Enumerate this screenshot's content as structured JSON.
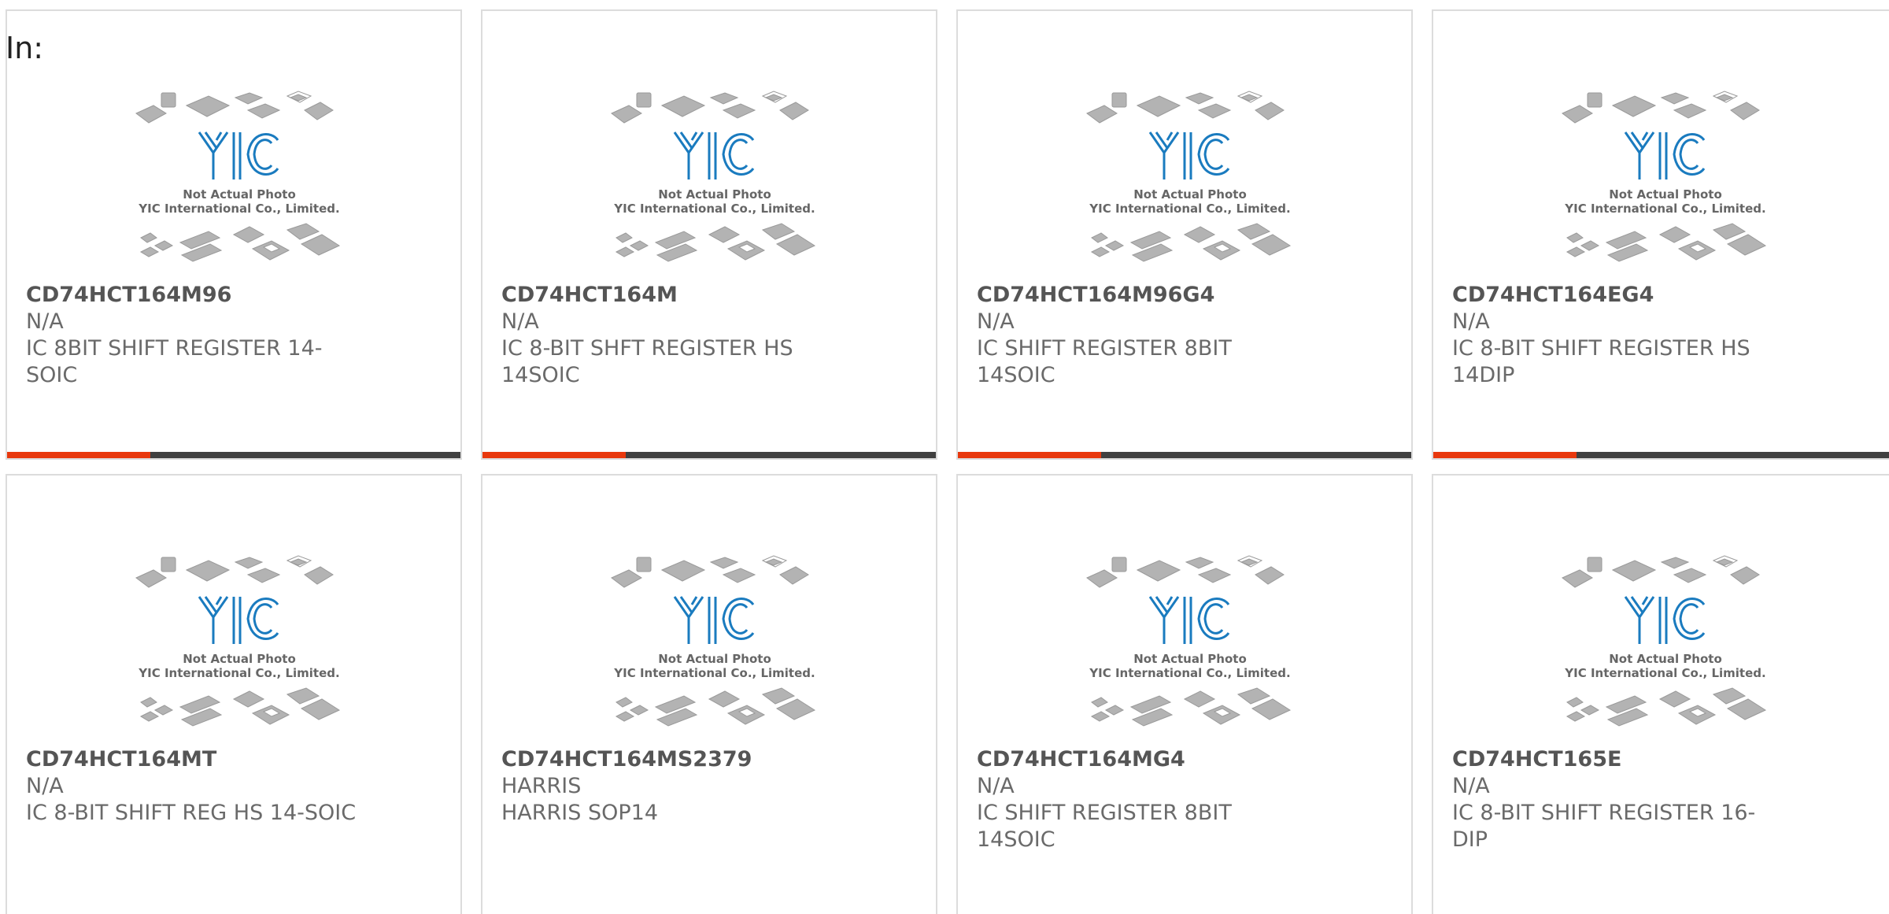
{
  "header": {
    "label": "In:"
  },
  "colors": {
    "accent": "#e8380d",
    "bar_dark": "#404040",
    "logo_blue": "#1a7bbf",
    "chip_gray": "#b3b3b3",
    "border": "#dcdcdc"
  },
  "placeholder_image": {
    "icon": "yic-logo-icon",
    "logo_text": "YIC",
    "line1": "Not Actual Photo",
    "line2": "YIC International Co., Limited."
  },
  "products": [
    {
      "part": "CD74HCT164M96",
      "manufacturer": "N/A",
      "desc1": "IC 8BIT SHIFT REGISTER 14-",
      "desc2": "SOIC"
    },
    {
      "part": "CD74HCT164M",
      "manufacturer": "N/A",
      "desc1": "IC 8-BIT SHFT REGISTER HS",
      "desc2": "14SOIC"
    },
    {
      "part": "CD74HCT164M96G4",
      "manufacturer": "N/A",
      "desc1": "IC SHIFT REGISTER 8BIT 14SOIC",
      "desc2": ""
    },
    {
      "part": "CD74HCT164EG4",
      "manufacturer": "N/A",
      "desc1": "IC 8-BIT SHIFT REGISTER HS",
      "desc2": "14DIP"
    },
    {
      "part": "CD74HCT164MT",
      "manufacturer": "N/A",
      "desc1": "IC 8-BIT SHIFT REG HS 14-SOIC",
      "desc2": ""
    },
    {
      "part": "CD74HCT164MS2379",
      "manufacturer": "HARRIS",
      "desc1": "HARRIS SOP14",
      "desc2": ""
    },
    {
      "part": "CD74HCT164MG4",
      "manufacturer": "N/A",
      "desc1": "IC SHIFT REGISTER 8BIT 14SOIC",
      "desc2": ""
    },
    {
      "part": "CD74HCT165E",
      "manufacturer": "N/A",
      "desc1": "IC 8-BIT SHIFT REGISTER 16-DIP",
      "desc2": ""
    }
  ]
}
